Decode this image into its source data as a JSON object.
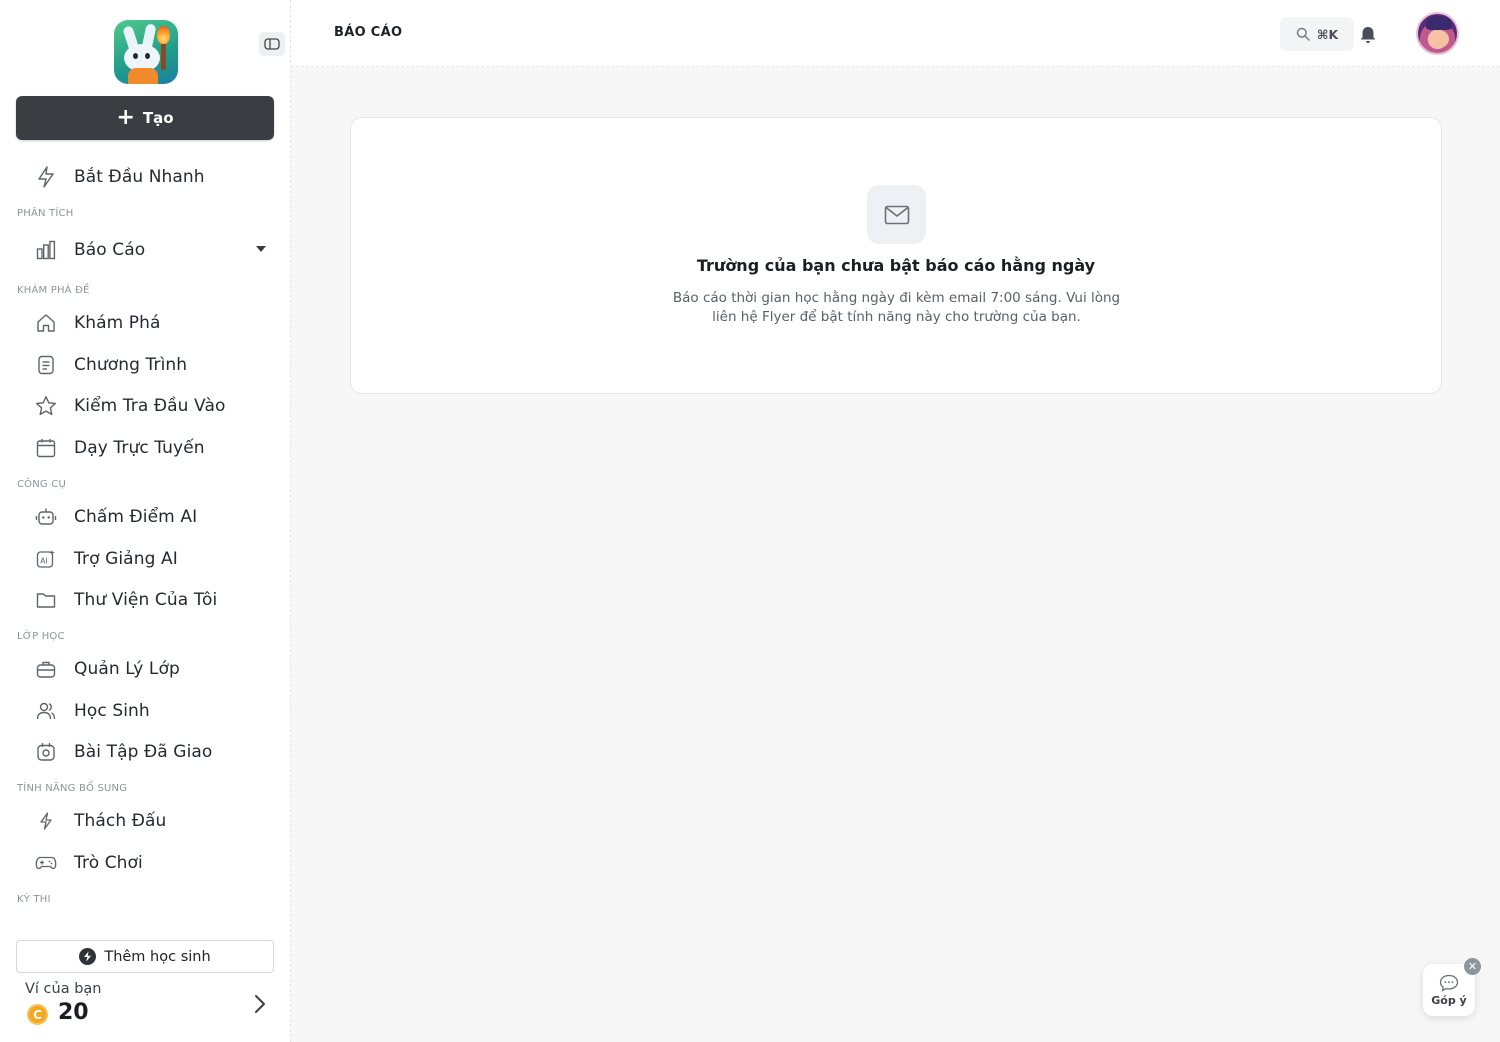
{
  "sidebar": {
    "create_label": "Tạo",
    "quick_start": "Bắt Đầu Nhanh",
    "sections": {
      "analytics": "PHÂN TÍCH",
      "explore": "KHÁM PHÁ ĐỀ",
      "tools": "CÔNG CỤ",
      "classes": "LỚP HỌC",
      "extras": "TÍNH NĂNG BỔ SUNG",
      "exams": "KỲ THI"
    },
    "items": {
      "reports": "Báo Cáo",
      "explore": "Khám Phá",
      "program": "Chương Trình",
      "placement_test": "Kiểm Tra Đầu Vào",
      "online_teaching": "Dạy Trực Tuyến",
      "ai_grading": "Chấm Điểm AI",
      "ai_assistant": "Trợ Giảng AI",
      "my_library": "Thư Viện Của Tôi",
      "class_management": "Quản Lý Lớp",
      "students": "Học Sinh",
      "assigned_homework": "Bài Tập Đã Giao",
      "challenge": "Thách Đấu",
      "games": "Trò Chơi"
    },
    "add_student": "Thêm học sinh",
    "wallet": {
      "label": "Ví của bạn",
      "coin_symbol": "C",
      "value": "20"
    }
  },
  "header": {
    "title": "BÁO CÁO",
    "search_shortcut": "⌘K"
  },
  "main": {
    "empty_title": "Trường của bạn chưa bật báo cáo hằng ngày",
    "empty_description": "Báo cáo thời gian học hằng ngày đi kèm email 7:00 sáng. Vui lòng liên hệ Flyer để bật tính năng này cho trường của bạn."
  },
  "feedback": {
    "label": "Góp ý",
    "close": "✕"
  },
  "colors": {
    "create_button": "#3b3d42",
    "coin": "#f5a623",
    "background": "#f7f7f8"
  }
}
